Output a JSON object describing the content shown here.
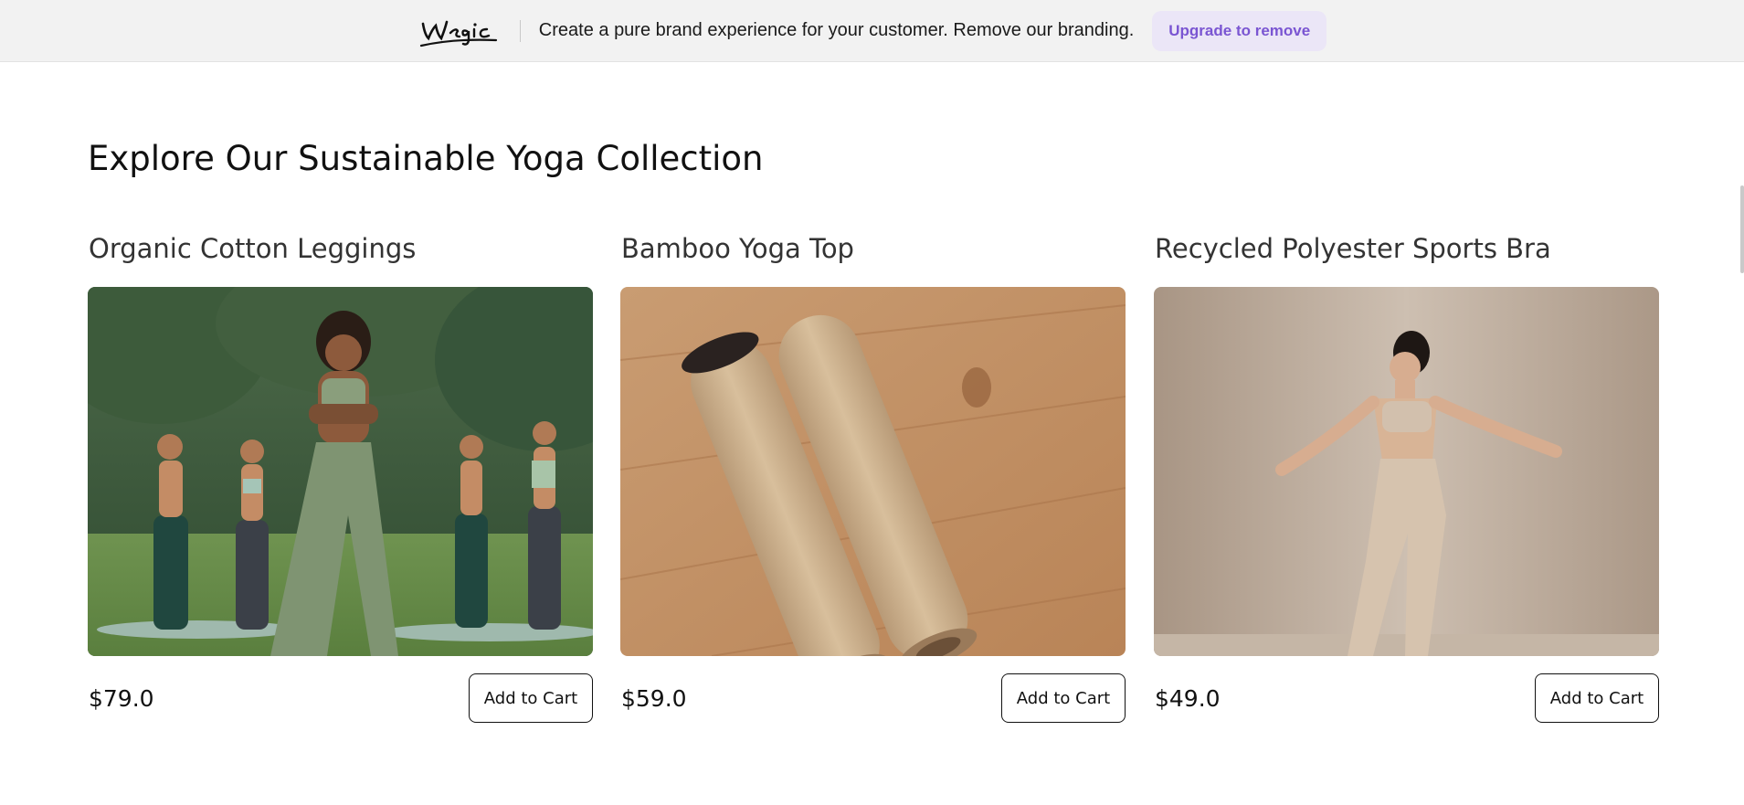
{
  "banner": {
    "logo_text": "Wegic",
    "message": "Create a pure brand experience for your customer. Remove our branding.",
    "upgrade_label": "Upgrade to remove"
  },
  "section": {
    "title": "Explore Our Sustainable Yoga Collection"
  },
  "products": [
    {
      "name": "Organic Cotton Leggings",
      "price": "$79.0",
      "cart_label": "Add to Cart",
      "image": "group-yoga-photo"
    },
    {
      "name": "Bamboo Yoga Top",
      "price": "$59.0",
      "cart_label": "Add to Cart",
      "image": "rolled-yoga-mats-photo"
    },
    {
      "name": "Recycled Polyester Sports Bra",
      "price": "$49.0",
      "cart_label": "Add to Cart",
      "image": "dancer-photo"
    }
  ],
  "colors": {
    "banner_bg": "#f2f2f2",
    "upgrade_bg": "#ebe6f7",
    "upgrade_text": "#7a55d2"
  }
}
